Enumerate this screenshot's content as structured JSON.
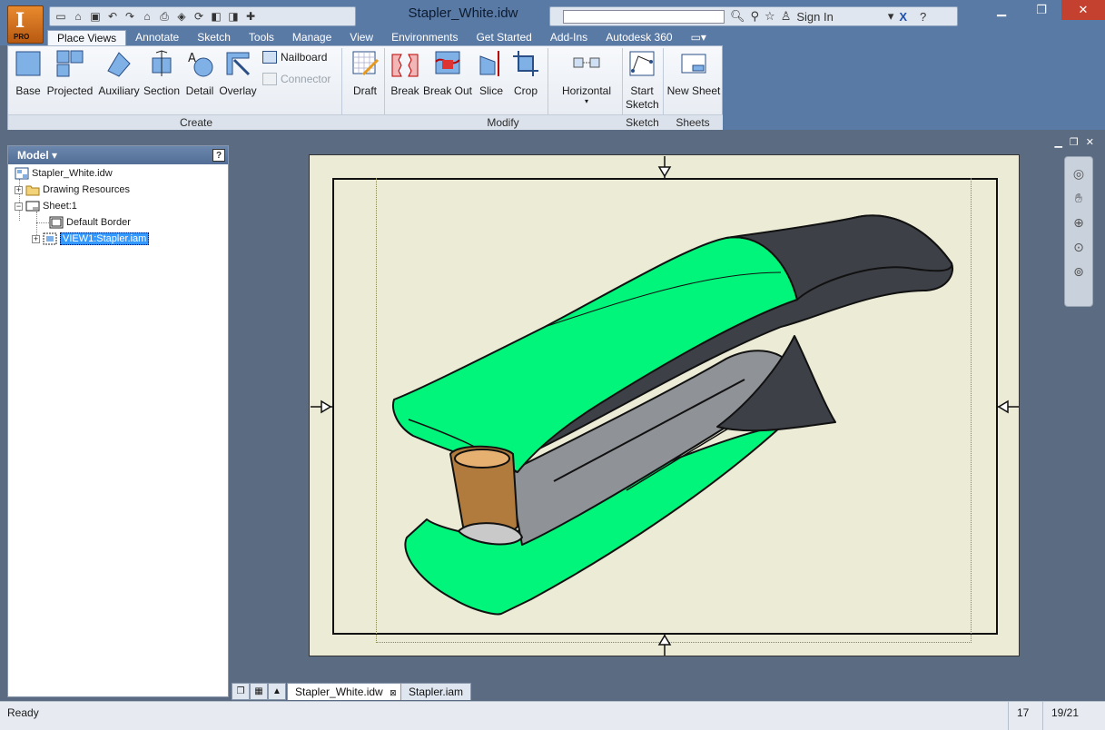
{
  "window": {
    "title": "Stapler_White.idw",
    "app_edition": "PRO",
    "app_logo": "I",
    "signin": "Sign In",
    "search_placeholder": ""
  },
  "ribbon_tabs": [
    "Place Views",
    "Annotate",
    "Sketch",
    "Tools",
    "Manage",
    "View",
    "Environments",
    "Get Started",
    "Add-Ins",
    "Autodesk 360"
  ],
  "ribbon": {
    "create": {
      "label": "Create",
      "buttons": [
        "Base",
        "Projected",
        "Auxiliary",
        "Section",
        "Detail",
        "Overlay"
      ],
      "small": [
        {
          "label": "Nailboard",
          "enabled": true
        },
        {
          "label": "Connector",
          "enabled": false
        }
      ]
    },
    "draft": {
      "label": "Draft"
    },
    "modify": {
      "label": "Modify",
      "buttons": [
        "Break",
        "Break Out",
        "Slice",
        "Crop"
      ],
      "horizontal": "Horizontal"
    },
    "sketch": {
      "label": "Sketch",
      "button_line1": "Start",
      "button_line2": "Sketch"
    },
    "sheets": {
      "label": "Sheets",
      "button": "New Sheet"
    }
  },
  "browser": {
    "title": "Model",
    "items": {
      "root": "Stapler_White.idw",
      "resources": "Drawing Resources",
      "sheet": "Sheet:1",
      "border": "Default Border",
      "view": "VIEW1:Stapler.iam"
    }
  },
  "doc_tabs": {
    "active": "Stapler_White.idw",
    "other": "Stapler.iam"
  },
  "status": {
    "text": "Ready",
    "value1": "17",
    "value2": "19/21"
  },
  "colors": {
    "stapler_green": "#00f57a",
    "stapler_dark": "#3d4147",
    "sheet": "#ecebd6",
    "background": "#5b6b82"
  }
}
